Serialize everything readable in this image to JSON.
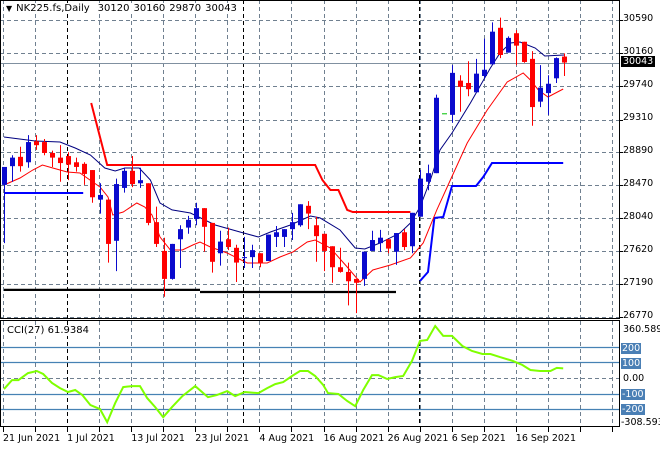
{
  "header": {
    "symbol": "NK225.fs,Daily",
    "open": "30120",
    "high": "30160",
    "low": "29870",
    "close": "30043"
  },
  "cci_header": {
    "label": "CCI(27)",
    "value": "61.9384"
  },
  "colors": {
    "up": "#0A0ACD",
    "down": "#FF0000",
    "ma_fast": "#000080",
    "ma_slow": "#FF0000",
    "stop_red": "#FF0000",
    "stop_blue": "#0000FF",
    "support": "#000000",
    "cci": "#7FFF00",
    "cci_levels": "#4682B4",
    "grid": "#708090"
  },
  "price_axis": {
    "labels": [
      "30590",
      "30160",
      "29740",
      "29310",
      "28890",
      "28470",
      "28040",
      "27620",
      "27190",
      "26770"
    ],
    "current_price": "30043"
  },
  "cci_axis": {
    "max": "360.5895",
    "l200": "200",
    "l100": "100",
    "zero": "0.00",
    "m100": "-100",
    "m200": "-200",
    "min": "-308.593"
  },
  "date_axis": [
    "21 Jun 2021",
    "1 Jul 2021",
    "13 Jul 2021",
    "23 Jul 2021",
    "4 Aug 2021",
    "16 Aug 2021",
    "26 Aug 2021",
    "6 Sep 2021",
    "16 Sep 2021"
  ],
  "chart_data": {
    "type": "candlestick",
    "ylim": [
      26770,
      30590
    ],
    "candles_ohlc": [
      [
        28470,
        28700,
        27720,
        28700
      ],
      [
        28710,
        28850,
        28510,
        28820
      ],
      [
        28830,
        28960,
        28640,
        28710
      ],
      [
        28760,
        29110,
        28690,
        29020
      ],
      [
        29030,
        29110,
        28920,
        28980
      ],
      [
        29020,
        29060,
        28850,
        28880
      ],
      [
        28880,
        28910,
        28700,
        28820
      ],
      [
        28820,
        28980,
        28510,
        28750
      ],
      [
        28840,
        28890,
        28530,
        28730
      ],
      [
        28760,
        28820,
        28640,
        28700
      ],
      [
        28740,
        28760,
        28470,
        28610
      ],
      [
        28660,
        28660,
        28240,
        28310
      ],
      [
        28280,
        28490,
        28100,
        28340
      ],
      [
        28280,
        28280,
        27470,
        27710
      ],
      [
        27750,
        28550,
        27360,
        28480
      ],
      [
        28430,
        28690,
        28370,
        28650
      ],
      [
        28650,
        28840,
        28440,
        28480
      ],
      [
        28490,
        28690,
        28430,
        28530
      ],
      [
        28490,
        28490,
        27950,
        27980
      ],
      [
        27990,
        28190,
        27670,
        27710
      ],
      [
        27620,
        27790,
        27030,
        27260
      ],
      [
        27260,
        27710,
        27250,
        27710
      ],
      [
        27770,
        27950,
        27400,
        27900
      ],
      [
        27920,
        28070,
        27840,
        28020
      ],
      [
        28030,
        28240,
        27950,
        28170
      ],
      [
        28170,
        28170,
        27610,
        27930
      ],
      [
        27980,
        27980,
        27340,
        27480
      ],
      [
        27590,
        27880,
        27430,
        27740
      ],
      [
        27770,
        27920,
        27630,
        27670
      ],
      [
        27660,
        27700,
        27220,
        27470
      ],
      [
        27530,
        27800,
        27400,
        27540
      ],
      [
        27540,
        27700,
        27400,
        27630
      ],
      [
        27590,
        27590,
        27410,
        27470
      ],
      [
        27490,
        27830,
        27490,
        27830
      ],
      [
        27800,
        27940,
        27670,
        27860
      ],
      [
        27800,
        27900,
        27670,
        27900
      ],
      [
        27900,
        28110,
        27760,
        27990
      ],
      [
        27950,
        28220,
        27930,
        28220
      ],
      [
        28200,
        28260,
        27900,
        28100
      ],
      [
        27950,
        28060,
        27480,
        27810
      ],
      [
        27840,
        27840,
        27360,
        27620
      ],
      [
        27680,
        27680,
        27210,
        27410
      ],
      [
        27410,
        27660,
        27340,
        27350
      ],
      [
        27350,
        27470,
        26920,
        27230
      ],
      [
        27260,
        27260,
        26820,
        27210
      ],
      [
        27260,
        27610,
        27170,
        27610
      ],
      [
        27620,
        27880,
        27620,
        27760
      ],
      [
        27720,
        27890,
        27610,
        27790
      ],
      [
        27770,
        27770,
        27590,
        27650
      ],
      [
        27610,
        27850,
        27440,
        27850
      ],
      [
        27860,
        27900,
        27630,
        27670
      ],
      [
        27680,
        28110,
        27590,
        28110
      ],
      [
        28060,
        28660,
        28060,
        28550
      ],
      [
        28510,
        28730,
        28400,
        28620
      ],
      [
        28620,
        29630,
        28620,
        29590
      ],
      [
        29390,
        29390,
        29390,
        29390
      ],
      [
        29370,
        30010,
        29270,
        29910
      ],
      [
        29810,
        29880,
        29410,
        29730
      ],
      [
        29780,
        30060,
        29610,
        29700
      ],
      [
        29660,
        30090,
        29660,
        29900
      ],
      [
        29870,
        30350,
        29840,
        29950
      ],
      [
        30020,
        30560,
        30020,
        30440
      ],
      [
        30490,
        30620,
        30100,
        30140
      ],
      [
        30170,
        30380,
        30170,
        30360
      ],
      [
        30420,
        30460,
        30010,
        30260
      ],
      [
        30310,
        30310,
        30040,
        30050
      ],
      [
        30090,
        30190,
        29230,
        29470
      ],
      [
        29540,
        30010,
        29470,
        29720
      ],
      [
        29650,
        29880,
        29370,
        29770
      ],
      [
        29840,
        30110,
        29780,
        30100
      ],
      [
        30120,
        30160,
        29870,
        30043
      ]
    ],
    "ma_fast": [
      [
        0,
        29085
      ],
      [
        3.9,
        29034
      ],
      [
        7,
        29021
      ],
      [
        8.9,
        28944
      ],
      [
        10.8,
        28854
      ],
      [
        12.6,
        28687
      ],
      [
        13.9,
        28648
      ],
      [
        15.1,
        28687
      ],
      [
        16.9,
        28687
      ],
      [
        18.3,
        28532
      ],
      [
        19.5,
        28236
      ],
      [
        21,
        28147
      ],
      [
        23.3,
        28108
      ],
      [
        26.4,
        27953
      ],
      [
        29.5,
        27863
      ],
      [
        31.8,
        27799
      ],
      [
        33.3,
        27863
      ],
      [
        35.8,
        27953
      ],
      [
        38.3,
        28069
      ],
      [
        39.5,
        28044
      ],
      [
        42,
        27889
      ],
      [
        43.9,
        27658
      ],
      [
        45.1,
        27645
      ],
      [
        47,
        27722
      ],
      [
        49.5,
        27850
      ],
      [
        50.8,
        27979
      ],
      [
        52,
        28185
      ],
      [
        53.3,
        28532
      ],
      [
        54.5,
        28918
      ],
      [
        56,
        29137
      ],
      [
        58.3,
        29523
      ],
      [
        60.8,
        29973
      ],
      [
        62,
        30166
      ],
      [
        63.3,
        30294
      ],
      [
        64.5,
        30307
      ],
      [
        66.4,
        30230
      ],
      [
        67.6,
        30127
      ],
      [
        70,
        30140
      ]
    ],
    "ma_slow": [
      [
        0,
        28468
      ],
      [
        2,
        28558
      ],
      [
        3.6,
        28661
      ],
      [
        4.8,
        28725
      ],
      [
        6.1,
        28687
      ],
      [
        7.9,
        28635
      ],
      [
        9.5,
        28622
      ],
      [
        11.1,
        28507
      ],
      [
        12,
        28442
      ],
      [
        13,
        28314
      ],
      [
        13.6,
        28082
      ],
      [
        14.9,
        28121
      ],
      [
        16.6,
        28236
      ],
      [
        17.6,
        28185
      ],
      [
        18.5,
        28082
      ],
      [
        19.5,
        27799
      ],
      [
        20.8,
        27632
      ],
      [
        22.3,
        27632
      ],
      [
        23.6,
        27696
      ],
      [
        24.5,
        27735
      ],
      [
        25.8,
        27670
      ],
      [
        27.9,
        27593
      ],
      [
        30.4,
        27465
      ],
      [
        32.9,
        27465
      ],
      [
        34.5,
        27542
      ],
      [
        36.1,
        27606
      ],
      [
        37.9,
        27735
      ],
      [
        38.9,
        27760
      ],
      [
        40.8,
        27658
      ],
      [
        42.9,
        27413
      ],
      [
        44.5,
        27220
      ],
      [
        46.1,
        27375
      ],
      [
        48.3,
        27439
      ],
      [
        50.8,
        27529
      ],
      [
        52.4,
        27722
      ],
      [
        54.1,
        28147
      ],
      [
        55.4,
        28442
      ],
      [
        57.9,
        29008
      ],
      [
        60.4,
        29433
      ],
      [
        62.9,
        29793
      ],
      [
        64.9,
        29908
      ],
      [
        65.8,
        29818
      ],
      [
        66.8,
        29690
      ],
      [
        68,
        29600
      ],
      [
        69.9,
        29703
      ]
    ],
    "stop_red": [
      [
        10.9,
        29523
      ],
      [
        12.9,
        28725
      ],
      [
        38.9,
        28725
      ],
      [
        39.8,
        28532
      ],
      [
        40.8,
        28404
      ],
      [
        41.8,
        28404
      ],
      [
        42.9,
        28147
      ],
      [
        43.6,
        28121
      ],
      [
        50.8,
        28121
      ]
    ],
    "stop_blue_1": [
      [
        0,
        28365
      ],
      [
        9.9,
        28365
      ]
    ],
    "stop_blue_2": [
      [
        52,
        27233
      ],
      [
        53,
        27349
      ],
      [
        53.8,
        28044
      ],
      [
        54.9,
        28056
      ],
      [
        56,
        28455
      ],
      [
        59,
        28455
      ],
      [
        59.9,
        28571
      ],
      [
        61,
        28751
      ],
      [
        69.9,
        28751
      ]
    ],
    "support_1": [
      [
        0,
        27118
      ],
      [
        24.5,
        27118
      ]
    ],
    "support_2": [
      [
        24.5,
        27092
      ],
      [
        49,
        27092
      ]
    ],
    "cci": [
      [
        0,
        -71
      ],
      [
        1,
        -13
      ],
      [
        1.8,
        -13
      ],
      [
        3,
        32
      ],
      [
        4.1,
        45
      ],
      [
        4.9,
        26
      ],
      [
        6,
        -32
      ],
      [
        7,
        -65
      ],
      [
        8,
        -90
      ],
      [
        8.9,
        -77
      ],
      [
        9.8,
        -110
      ],
      [
        10.8,
        -174
      ],
      [
        12,
        -200
      ],
      [
        12.9,
        -284
      ],
      [
        13.9,
        -161
      ],
      [
        14.9,
        -58
      ],
      [
        16,
        -52
      ],
      [
        17,
        -52
      ],
      [
        17.9,
        -129
      ],
      [
        18.9,
        -187
      ],
      [
        19.9,
        -252
      ],
      [
        21,
        -187
      ],
      [
        22.3,
        -116
      ],
      [
        23.9,
        -52
      ],
      [
        25.5,
        -123
      ],
      [
        26.6,
        -110
      ],
      [
        27.9,
        -84
      ],
      [
        28.9,
        -116
      ],
      [
        30.1,
        -90
      ],
      [
        31.8,
        -97
      ],
      [
        32.9,
        -65
      ],
      [
        33.9,
        -39
      ],
      [
        34.9,
        -26
      ],
      [
        36,
        13
      ],
      [
        37,
        45
      ],
      [
        38,
        45
      ],
      [
        38.9,
        13
      ],
      [
        39.9,
        -45
      ],
      [
        40.5,
        -97
      ],
      [
        41.8,
        -103
      ],
      [
        42.9,
        -148
      ],
      [
        43.9,
        -181
      ],
      [
        44.9,
        -77
      ],
      [
        46,
        19
      ],
      [
        46.8,
        19
      ],
      [
        47.9,
        -6
      ],
      [
        48.9,
        6
      ],
      [
        49.9,
        13
      ],
      [
        51,
        110
      ],
      [
        52,
        239
      ],
      [
        52.9,
        245
      ],
      [
        53.9,
        335
      ],
      [
        54.9,
        271
      ],
      [
        56,
        271
      ],
      [
        57.3,
        206
      ],
      [
        58.5,
        174
      ],
      [
        59.8,
        155
      ],
      [
        60.8,
        155
      ],
      [
        62,
        135
      ],
      [
        63.6,
        110
      ],
      [
        64.8,
        84
      ],
      [
        65.8,
        52
      ],
      [
        67,
        45
      ],
      [
        68.3,
        45
      ],
      [
        69.1,
        65
      ],
      [
        69.9,
        62
      ]
    ],
    "cci_ylim": [
      -308.593,
      360.5895
    ],
    "cci_levels": [
      200,
      100,
      0,
      -100,
      -200
    ]
  }
}
